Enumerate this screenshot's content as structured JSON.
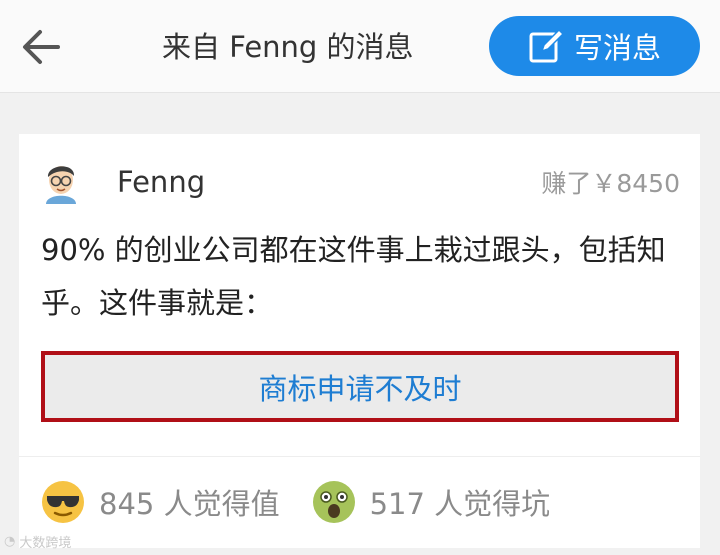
{
  "header": {
    "title": "来自 Fenng 的消息",
    "back_icon": "back-arrow-icon",
    "compose_label": "写消息",
    "compose_icon": "edit-icon",
    "accent_color": "#1e8ae8"
  },
  "message": {
    "author": "Fenng",
    "earned": "赚了￥8450",
    "text": "90% 的创业公司都在这件事上栽过跟头，包括知乎。这件事就是：",
    "answer": "商标申请不及时",
    "highlight_color": "#b00f17"
  },
  "reactions": [
    {
      "icon": "cool-face-icon",
      "label": "845 人觉得值"
    },
    {
      "icon": "shocked-face-icon",
      "label": "517 人觉得坑"
    }
  ],
  "watermark": {
    "text": "大数跨境"
  }
}
